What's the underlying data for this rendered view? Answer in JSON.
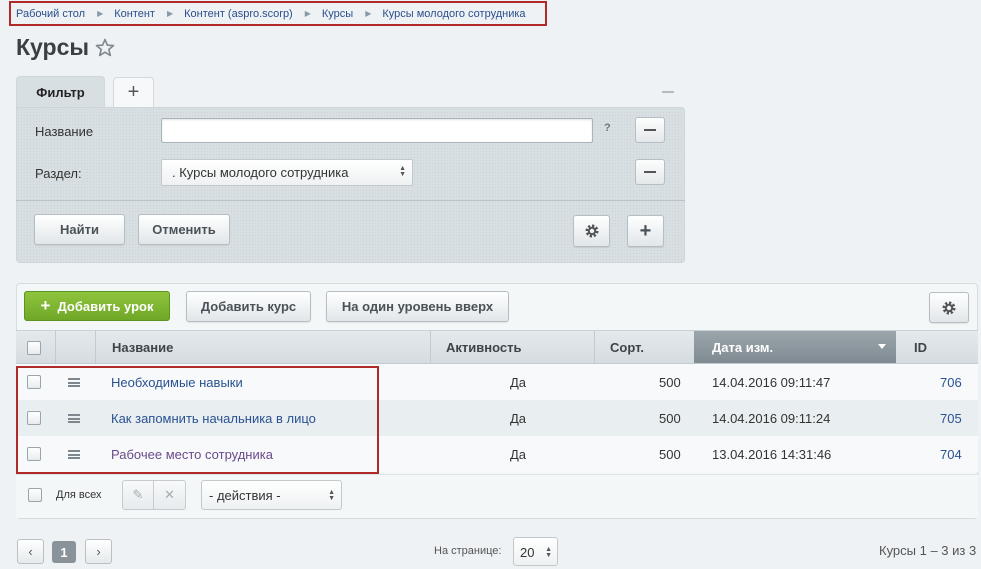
{
  "breadcrumb": [
    "Рабочий стол",
    "Контент",
    "Контент (aspro.scorp)",
    "Курсы",
    "Курсы молодого сотрудника"
  ],
  "page": {
    "title": "Курсы"
  },
  "filter": {
    "tab_label": "Фильтр",
    "tab_add": "+",
    "name_label": "Название",
    "name_value": "",
    "help": "?",
    "section_label": "Раздел:",
    "section_value": ". Курсы молодого сотрудника",
    "find_label": "Найти",
    "cancel_label": "Отменить"
  },
  "toolbar": {
    "add_lesson": "Добавить урок",
    "add_course": "Добавить курс",
    "level_up": "На один уровень вверх"
  },
  "table": {
    "headers": {
      "name": "Название",
      "active": "Активность",
      "sort": "Сорт.",
      "date": "Дата изм.",
      "id": "ID"
    },
    "rows": [
      {
        "name": "Необходимые навыки",
        "active": "Да",
        "sort": "500",
        "date": "14.04.2016 09:11:47",
        "id": "706"
      },
      {
        "name": "Как запомнить начальника в лицо",
        "active": "Да",
        "sort": "500",
        "date": "14.04.2016 09:11:24",
        "id": "705"
      },
      {
        "name": "Рабочее место сотрудника",
        "active": "Да",
        "sort": "500",
        "date": "13.04.2016 14:31:46",
        "id": "704"
      }
    ]
  },
  "footer": {
    "for_all": "Для всех",
    "actions": "- действия -"
  },
  "pagination": {
    "prev": "‹",
    "current": "1",
    "next": "›",
    "per_page_label": "На странице:",
    "per_page_value": "20",
    "summary": "Курсы 1 – 3 из 3"
  },
  "colors": {
    "accent_green": "#7ab32e",
    "highlight_red": "#b02a2a",
    "link": "#2a5291"
  }
}
